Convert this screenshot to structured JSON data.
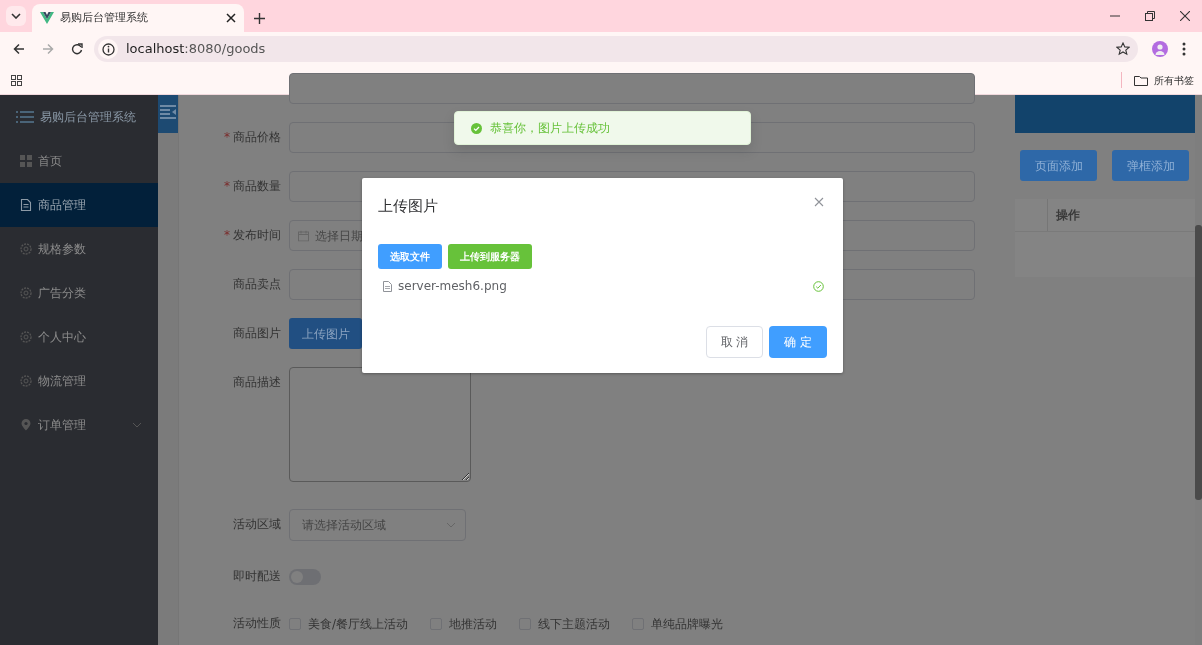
{
  "browser": {
    "tab_title": "易购后台管理系统",
    "url_host": "localhost",
    "url_rest": ":8080/goods",
    "bookmarks_folder": "所有书签"
  },
  "sidebar": {
    "title": "易购后台管理系统",
    "items": [
      {
        "label": "首页",
        "selected": false
      },
      {
        "label": "商品管理",
        "selected": true
      },
      {
        "label": "规格参数",
        "selected": false
      },
      {
        "label": "广告分类",
        "selected": false
      },
      {
        "label": "个人中心",
        "selected": false
      },
      {
        "label": "物流管理",
        "selected": false
      },
      {
        "label": "订单管理",
        "selected": false,
        "expanded": false
      }
    ]
  },
  "form": {
    "fields": [
      {
        "kind": "input"
      },
      {
        "kind": "input",
        "label": "商品价格",
        "required_mark": "*"
      },
      {
        "kind": "input",
        "label": "商品数量",
        "required_mark": "*"
      },
      {
        "kind": "date",
        "label": "发布时间",
        "required_mark": "*",
        "placeholder": "选择日期"
      },
      {
        "kind": "input",
        "label": "商品卖点"
      },
      {
        "kind": "button",
        "label": "商品图片",
        "button": "上传图片"
      },
      {
        "kind": "textarea",
        "label": "商品描述"
      },
      {
        "kind": "select",
        "label": "活动区域",
        "placeholder": "请选择活动区域"
      },
      {
        "kind": "switch",
        "label": "即时配送",
        "on": false
      },
      {
        "kind": "checkboxes",
        "label": "活动性质",
        "options": [
          {
            "label": "美食/餐厅线上活动",
            "checked": false
          },
          {
            "label": "地推活动",
            "checked": false
          },
          {
            "label": "线下主题活动",
            "checked": false
          },
          {
            "label": "单纯品牌曝光",
            "checked": false
          }
        ]
      }
    ]
  },
  "right_panel": {
    "buttons": [
      "页面添加",
      "弹框添加"
    ],
    "table": {
      "columns": [
        "操作"
      ]
    }
  },
  "toast": {
    "success": true,
    "message": "恭喜你，图片上传成功"
  },
  "dialog": {
    "title": "上传图片",
    "select_button": "选取文件",
    "upload_button": "上传到服务器",
    "files": [
      {
        "name": "server-mesh6.png",
        "uploaded": true
      }
    ],
    "cancel_button": "取 消",
    "confirm_button": "确 定"
  }
}
